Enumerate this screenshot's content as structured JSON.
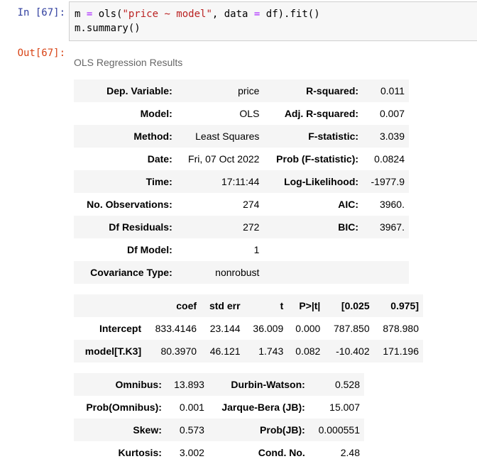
{
  "input_prompt": "In [67]:",
  "output_prompt": "Out[67]:",
  "code": {
    "line1": {
      "p1": "m ",
      "p2": "=",
      "p3": " ols(",
      "p4": "\"price ~ model\"",
      "p5": ", data ",
      "p6": "=",
      "p7": " df).fit()"
    },
    "line2": "m.summary()"
  },
  "caption": "OLS Regression Results",
  "table1": [
    [
      "Dep. Variable:",
      "price",
      "R-squared:",
      "0.011"
    ],
    [
      "Model:",
      "OLS",
      "Adj. R-squared:",
      "0.007"
    ],
    [
      "Method:",
      "Least Squares",
      "F-statistic:",
      "3.039"
    ],
    [
      "Date:",
      "Fri, 07 Oct 2022",
      "Prob (F-statistic):",
      "0.0824"
    ],
    [
      "Time:",
      "17:11:44",
      "Log-Likelihood:",
      "-1977.9"
    ],
    [
      "No. Observations:",
      "274",
      "AIC:",
      "3960."
    ],
    [
      "Df Residuals:",
      "272",
      "BIC:",
      "3967."
    ],
    [
      "Df Model:",
      "1",
      "",
      ""
    ],
    [
      "Covariance Type:",
      "nonrobust",
      "",
      ""
    ]
  ],
  "table2": {
    "header": [
      "",
      "coef",
      "std err",
      "t",
      "P>|t|",
      "[0.025",
      "0.975]"
    ],
    "rows": [
      [
        "Intercept",
        "833.4146",
        "23.144",
        "36.009",
        "0.000",
        "787.850",
        "878.980"
      ],
      [
        "model[T.K3]",
        "80.3970",
        "46.121",
        "1.743",
        "0.082",
        "-10.402",
        "171.196"
      ]
    ]
  },
  "table3": [
    [
      "Omnibus:",
      "13.893",
      "Durbin-Watson:",
      "0.528"
    ],
    [
      "Prob(Omnibus):",
      "0.001",
      "Jarque-Bera (JB):",
      "15.007"
    ],
    [
      "Skew:",
      "0.573",
      "Prob(JB):",
      "0.000551"
    ],
    [
      "Kurtosis:",
      "3.002",
      "Cond. No.",
      "2.48"
    ]
  ]
}
